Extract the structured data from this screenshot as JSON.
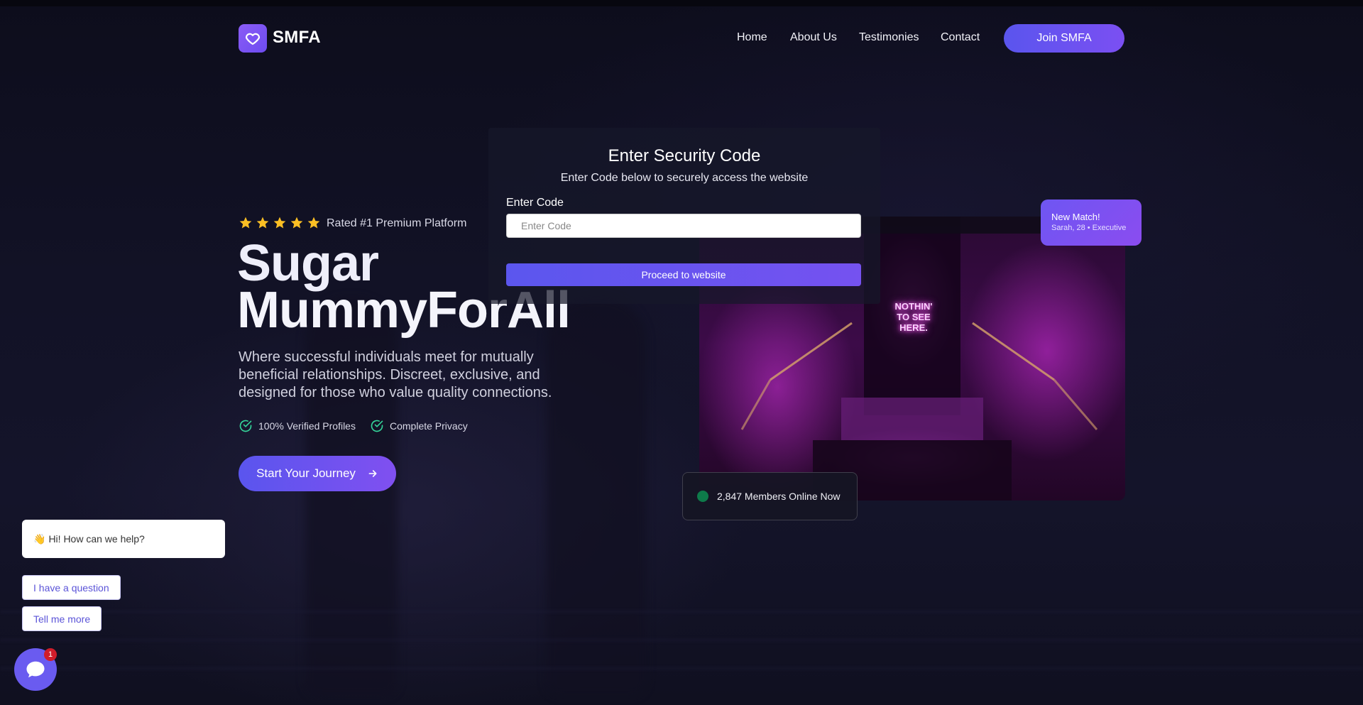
{
  "header": {
    "logo_text": "SMFA",
    "nav": [
      "Home",
      "About Us",
      "Testimonies",
      "Contact"
    ],
    "join_label": "Join SMFA"
  },
  "security": {
    "title": "Enter Security Code",
    "subtitle": "Enter Code below to securely access the website",
    "label": "Enter Code",
    "placeholder": "Enter Code",
    "value": "",
    "button": "Proceed to website"
  },
  "hero": {
    "rating_stars": 5,
    "rated_text": "Rated #1 Premium Platform",
    "title_line1": "Sugar",
    "title_line2": "MummyForAll",
    "description": "Where successful individuals meet for mutually beneficial relationships. Discreet, exclusive, and designed for those who value quality connections.",
    "features": [
      "100% Verified Profiles",
      "Complete Privacy"
    ],
    "cta_label": "Start Your Journey"
  },
  "image": {
    "neon_text": "NOTHIN' TO SEE HERE."
  },
  "match_card": {
    "title": "New Match!",
    "subtitle": "Sarah, 28 • Executive"
  },
  "online": {
    "text": "2,847 Members Online Now"
  },
  "chat": {
    "greeting_emoji": "👋",
    "greeting": "Hi! How can we help?",
    "options": [
      "I have a question",
      "Tell me more"
    ],
    "badge_count": "1"
  },
  "colors": {
    "accent": "#6d57f0",
    "star": "#fbbf24",
    "check": "#34d399",
    "online_dot": "#0e7a4a",
    "badge": "#d01d2a"
  },
  "icons": [
    "heart-icon",
    "star-icon",
    "check-circle-icon",
    "arrow-right-icon",
    "chat-icon"
  ]
}
